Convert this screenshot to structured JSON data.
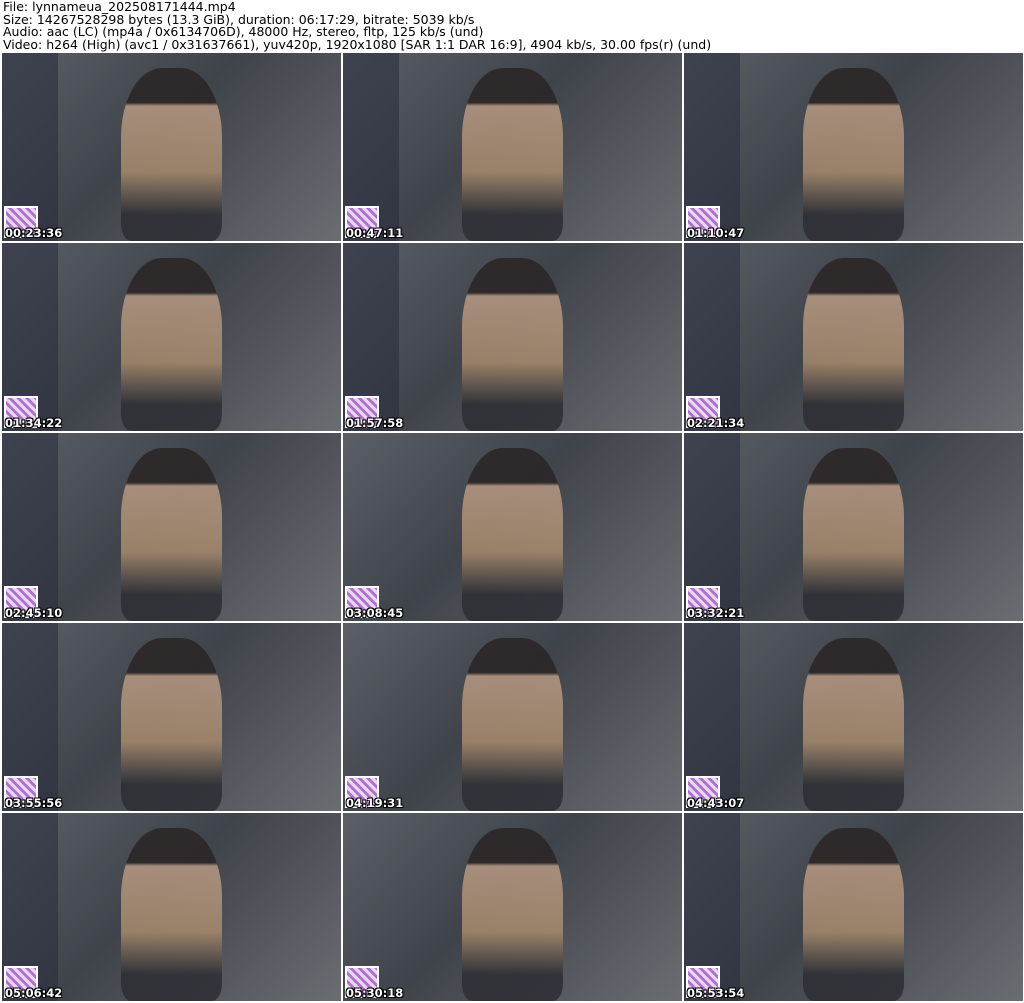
{
  "header": {
    "file": "File: lynnameua_202508171444.mp4",
    "size": "Size: 14267528298 bytes (13.3 GiB), duration: 06:17:29, bitrate: 5039 kb/s",
    "audio": "Audio: aac (LC) (mp4a / 0x6134706D), 48000 Hz, stereo, fltp, 125 kb/s (und)",
    "video": "Video: h264 (High) (avc1 / 0x31637661), yuv420p, 1920x1080 [SAR 1:1 DAR 16:9], 4904 kb/s, 30.00 fps(r) (und)"
  },
  "thumbnails": [
    {
      "timestamp": "00:23:36"
    },
    {
      "timestamp": "00:47:11"
    },
    {
      "timestamp": "01:10:47"
    },
    {
      "timestamp": "01:34:22"
    },
    {
      "timestamp": "01:57:58"
    },
    {
      "timestamp": "02:21:34"
    },
    {
      "timestamp": "02:45:10"
    },
    {
      "timestamp": "03:08:45"
    },
    {
      "timestamp": "03:32:21"
    },
    {
      "timestamp": "03:55:56"
    },
    {
      "timestamp": "04:19:31"
    },
    {
      "timestamp": "04:43:07"
    },
    {
      "timestamp": "05:06:42"
    },
    {
      "timestamp": "05:30:18"
    },
    {
      "timestamp": "05:53:54"
    }
  ]
}
